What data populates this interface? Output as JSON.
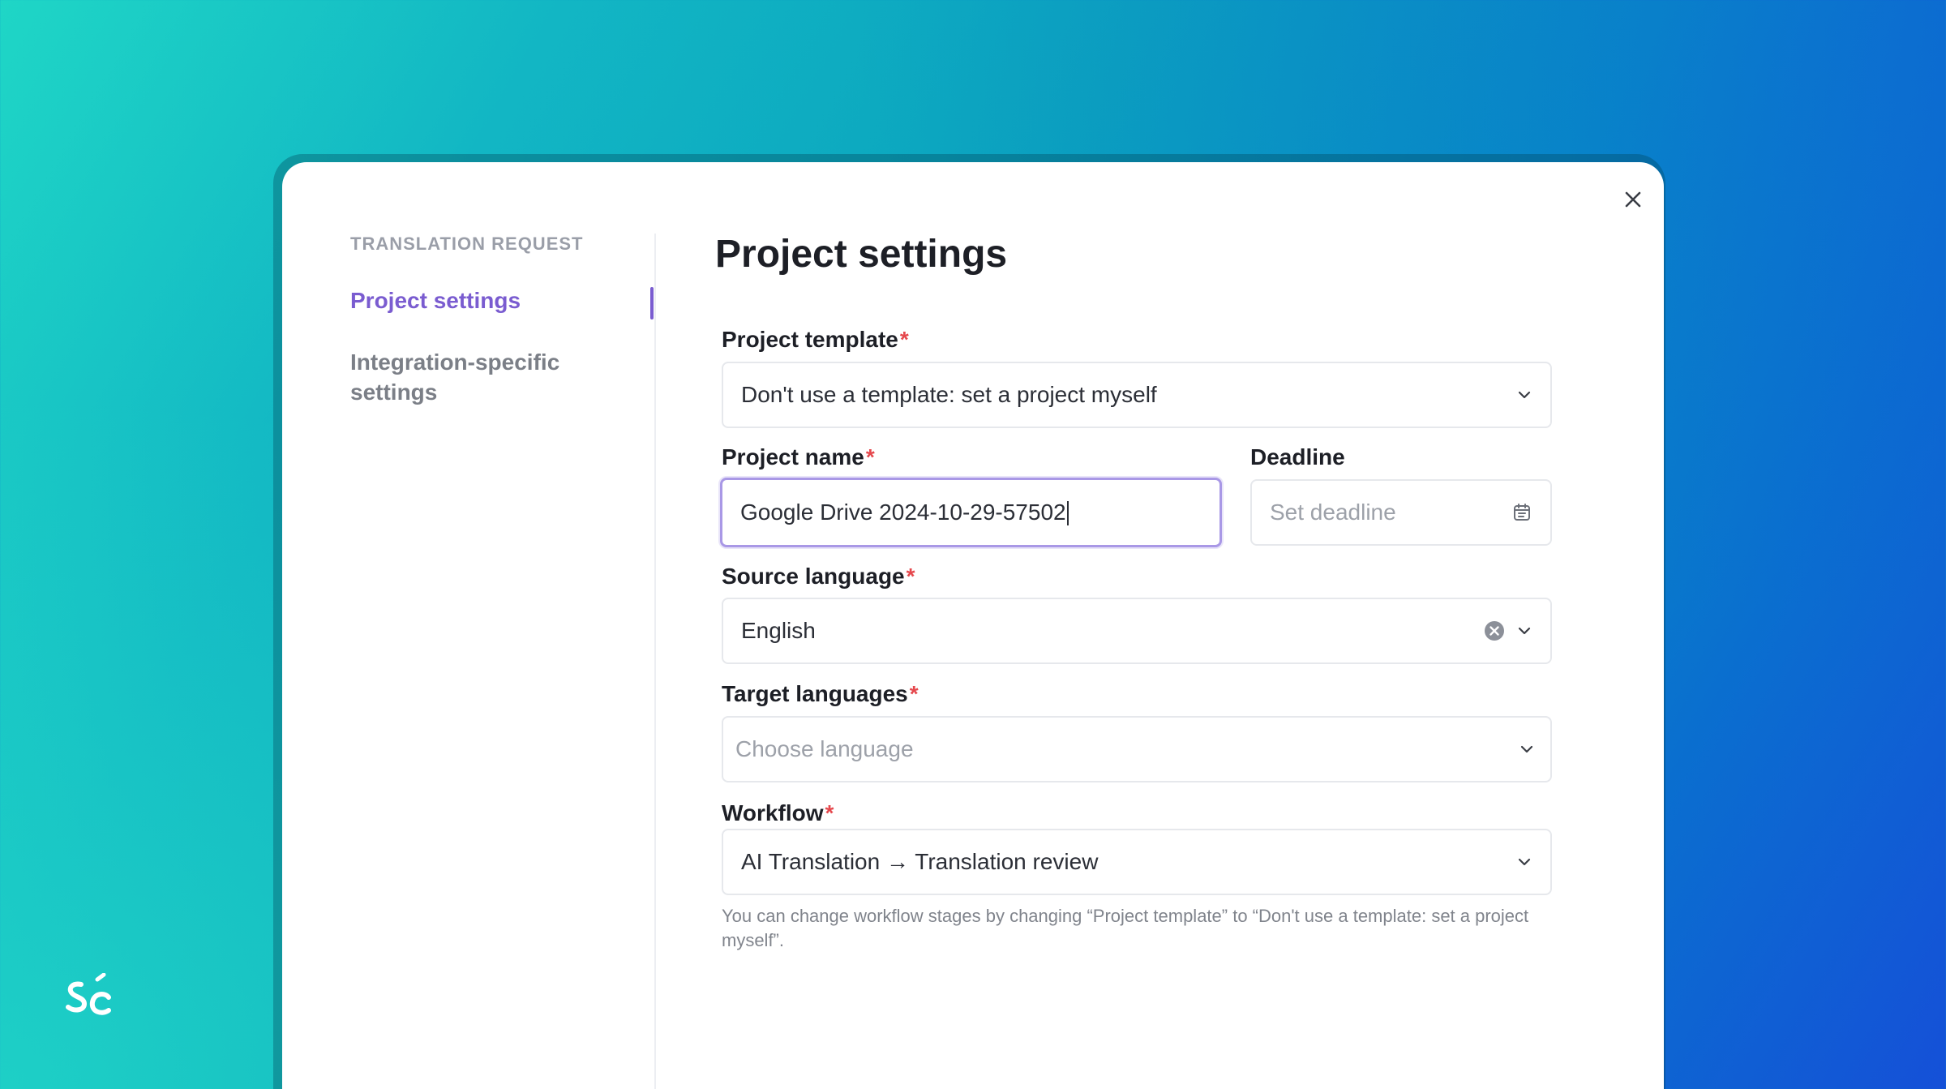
{
  "dialog": {
    "close_icon": "close-icon"
  },
  "sidebar": {
    "heading": "TRANSLATION REQUEST",
    "items": [
      {
        "label": "Project settings",
        "active": true
      },
      {
        "label": "Integration-specific settings",
        "line1": "Integration-specific",
        "line2": "settings",
        "active": false
      }
    ]
  },
  "main": {
    "title": "Project settings",
    "project_template": {
      "label": "Project template",
      "required": "*",
      "value": "Don't use a template: set a project myself",
      "icon": "chevron-down-icon"
    },
    "project_name": {
      "label": "Project name",
      "required": "*",
      "value": "Google Drive 2024-10-29-57502"
    },
    "deadline": {
      "label": "Deadline",
      "placeholder": "Set deadline",
      "icon": "calendar-icon"
    },
    "source_language": {
      "label": "Source language",
      "required": "*",
      "value": "English",
      "icons": [
        "clear-icon",
        "chevron-down-icon"
      ]
    },
    "target_languages": {
      "label": "Target languages",
      "required": "*",
      "placeholder": "Choose language",
      "icon": "chevron-down-icon"
    },
    "workflow": {
      "label": "Workflow",
      "required": "*",
      "value": "AI Translation → Translation review",
      "icon": "chevron-down-icon",
      "hint": "You can change workflow stages by changing “Project template” to “Don't use a template: set a project myself”."
    }
  },
  "brand": {
    "logo_icon": "smartcat-logo-icon",
    "accent": "#7a5cd0",
    "required_color": "#e5484d"
  }
}
